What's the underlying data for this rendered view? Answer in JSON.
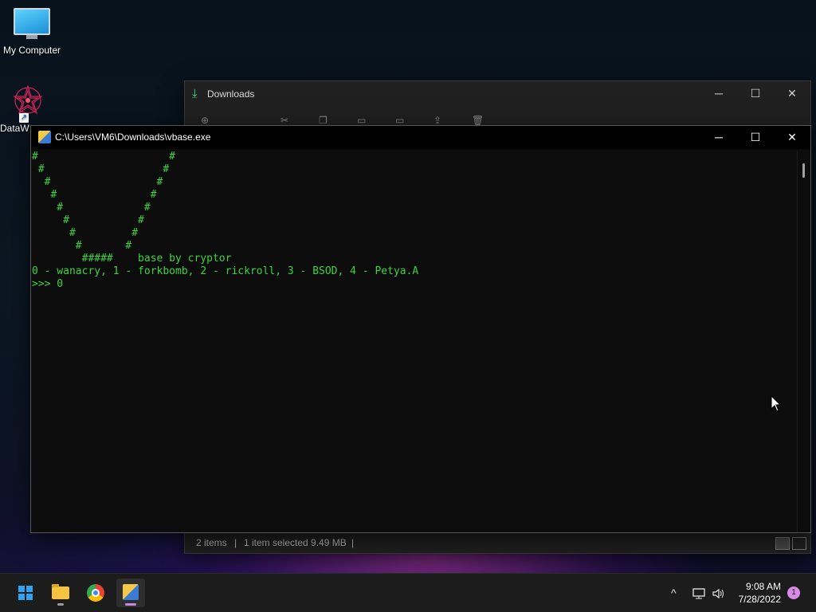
{
  "desktop": {
    "icons": [
      {
        "label": "My Computer",
        "icon": "monitor-icon"
      },
      {
        "label": "DataW",
        "icon": "datawiper-icon"
      }
    ]
  },
  "explorer": {
    "title": "Downloads",
    "icon": "download-icon",
    "controls": {
      "minimize": "─",
      "maximize": "☐",
      "close": "✕"
    },
    "status": {
      "items": "2 items",
      "sep": "|",
      "selected": "1 item selected  9.49 MB",
      "sep2": "|"
    }
  },
  "console": {
    "title": "C:\\Users\\VM6\\Downloads\\vbase.exe",
    "controls": {
      "minimize": "─",
      "maximize": "☐",
      "close": "✕"
    },
    "lines": [
      "#                     #",
      " #                   #",
      "  #                 #",
      "   #               #",
      "    #             #",
      "     #           #",
      "      #         #",
      "       #       #",
      "        #####    base by cryptor",
      "0 - wanacry, 1 - forkbomb, 2 - rickroll, 3 - BSOD, 4 - Petya.A",
      ">>> 0"
    ]
  },
  "taskbar": {
    "apps": [
      {
        "name": "start",
        "icon": "windows-logo-icon"
      },
      {
        "name": "file-explorer",
        "icon": "folder-icon"
      },
      {
        "name": "chrome",
        "icon": "chrome-icon"
      },
      {
        "name": "vbase",
        "icon": "console-app-icon"
      }
    ],
    "tray": {
      "chevron": "^",
      "network": "network-icon",
      "volume": "volume-icon"
    },
    "clock": {
      "time": "9:08 AM",
      "date": "7/28/2022"
    },
    "notifications": "1"
  },
  "colors": {
    "console_text": "#3cd43c",
    "accent": "#33a1f2"
  }
}
